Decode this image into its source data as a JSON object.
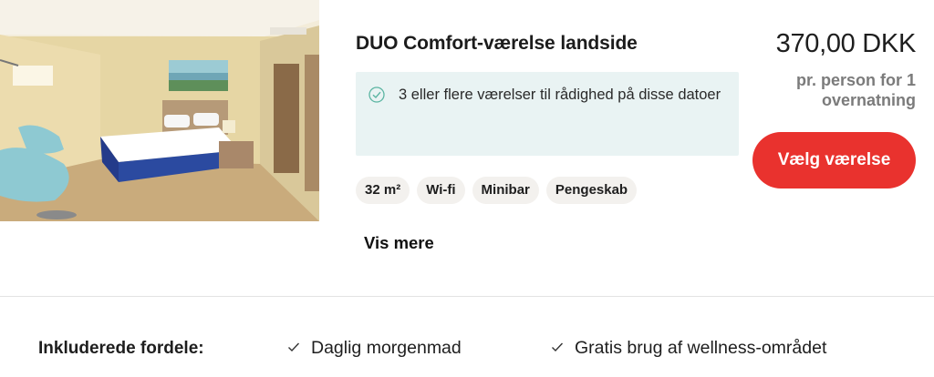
{
  "room": {
    "title": "DUO Comfort-værelse landside",
    "availability_text": "3 eller flere værelser til rådighed på disse datoer",
    "amenities": [
      "32 m²",
      "Wi-fi",
      "Minibar",
      "Pengeskab"
    ],
    "more_label": "Vis mere",
    "price": "370,00 DKK",
    "price_note": "pr. person for 1 overnatning",
    "select_label": "Vælg værelse"
  },
  "benefits": {
    "heading": "Inkluderede fordele:",
    "items": [
      "Daglig morgenmad",
      "Gratis brug af wellness-området"
    ]
  },
  "colors": {
    "accent": "#e9322e",
    "availability_bg": "#e9f3f3",
    "check": "#5bb5a2",
    "chip_bg": "#f3f1ee"
  },
  "icons": {
    "availability": "check-circle-icon",
    "benefit": "checkmark-icon"
  }
}
